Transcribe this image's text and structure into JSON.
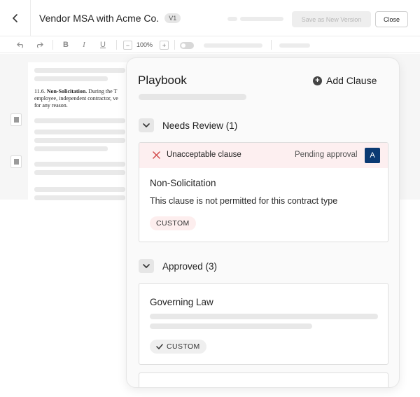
{
  "header": {
    "title": "Vendor MSA with Acme Co.",
    "version": "V1",
    "save_label": "Save as New Version",
    "close_label": "Close"
  },
  "toolbar": {
    "bold": "B",
    "italic": "I",
    "underline": "U",
    "zoom_minus": "−",
    "zoom_value": "100%",
    "zoom_plus": "+"
  },
  "document": {
    "section_num": "11.6.",
    "section_title": "Non-Solicitation.",
    "line1_rest": " During the T",
    "line2": "employee, independent contractor, ve",
    "line3": "for any reason."
  },
  "playbook": {
    "title": "Playbook",
    "add_clause_label": "Add Clause",
    "needs_review": {
      "label": "Needs Review (1)",
      "items": [
        {
          "alert": "Unacceptable clause",
          "status": "Pending approval",
          "assignee_initial": "A",
          "name": "Non-Solicitation",
          "description": "This clause is not permitted for this contract type",
          "tag": "CUSTOM"
        }
      ]
    },
    "approved": {
      "label": "Approved (3)",
      "items": [
        {
          "name": "Governing Law",
          "tag": "CUSTOM"
        }
      ]
    }
  },
  "colors": {
    "alert_bg": "#fdeff0",
    "alert_icon": "#d24a4a",
    "avatar_bg": "#0b3a73",
    "tag_red_bg": "#fdeeee"
  }
}
